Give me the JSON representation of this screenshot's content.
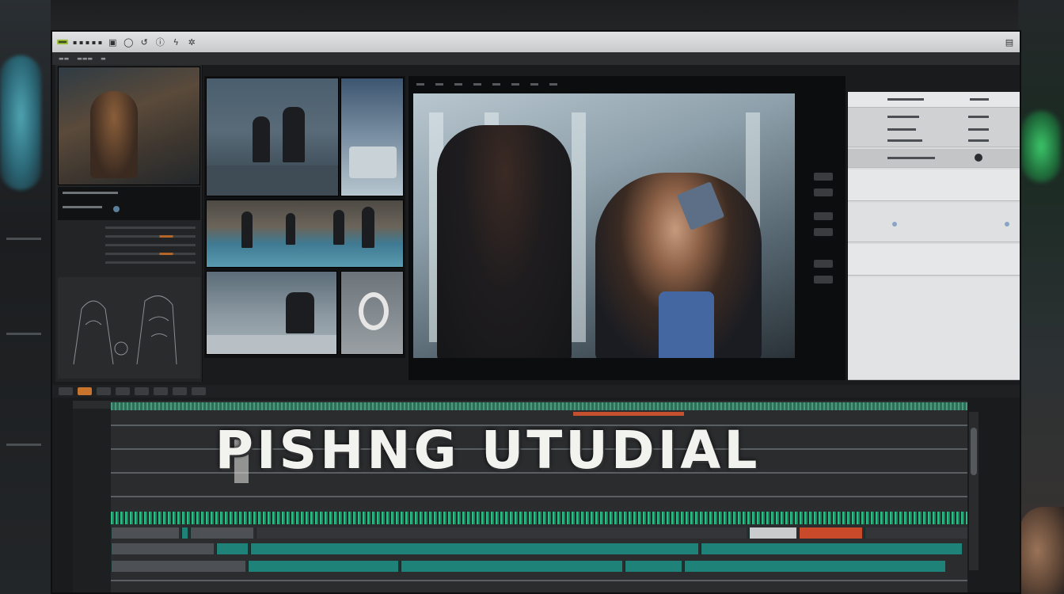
{
  "app": {
    "title_overlay": "PISHNG UTUDIAL"
  },
  "colors": {
    "timeline_teal": "#1e8278",
    "waveform_green": "#2bbf86",
    "accent_orange": "#c8742c",
    "marker_red": "#c84a2a",
    "menubar_bg": "#d4d5d6"
  },
  "menubar": {
    "tools": [
      {
        "icon": "selection-icon"
      },
      {
        "icon": "circle-icon"
      },
      {
        "icon": "undo-icon"
      },
      {
        "icon": "info-icon"
      },
      {
        "icon": "bolt-icon"
      },
      {
        "icon": "settings-icon"
      }
    ]
  }
}
